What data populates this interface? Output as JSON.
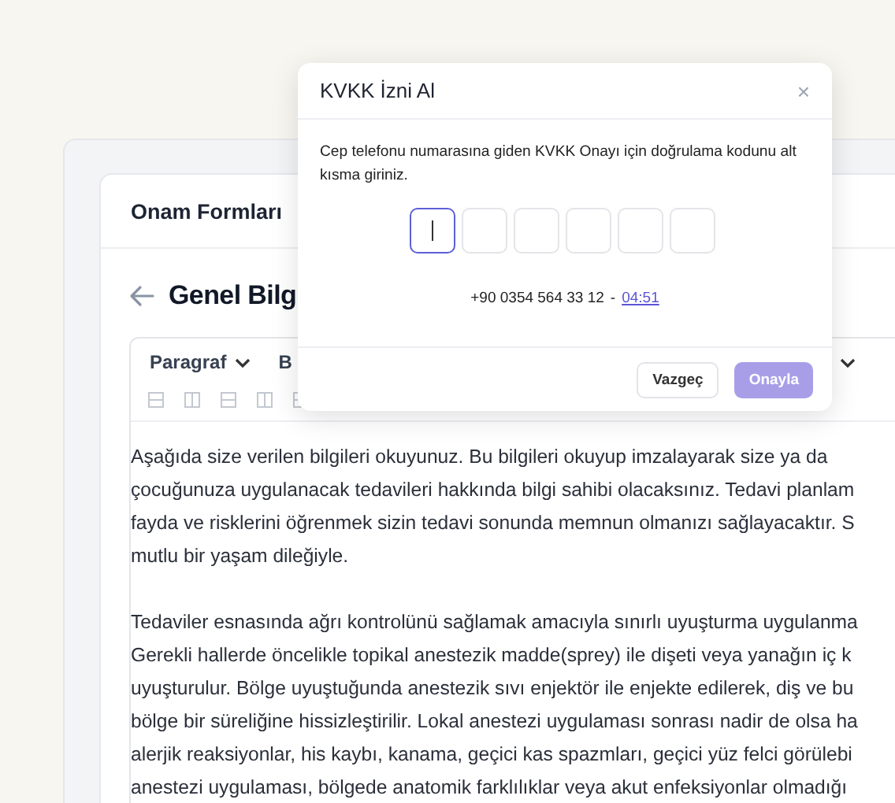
{
  "page": {
    "section_title": "Onam Formları",
    "heading": "Genel Bilg"
  },
  "editor": {
    "toolbar": {
      "block_style": "Paragraf",
      "bold_label": "B"
    },
    "paragraphs": [
      [
        "Aşağıda size verilen bilgileri okuyunuz. Bu bilgileri okuyup imzalayarak size ya da",
        "çocuğunuza uygulanacak tedavileri hakkında bilgi sahibi olacaksınız. Tedavi planlam",
        "fayda ve risklerini öğrenmek sizin tedavi sonunda memnun olmanızı sağlayacaktır. S",
        "mutlu bir yaşam dileğiyle."
      ],
      [
        "Tedaviler esnasında ağrı kontrolünü sağlamak amacıyla sınırlı uyuşturma uygulanma",
        "Gerekli hallerde öncelikle topikal anestezik madde(sprey) ile dişeti veya yanağın iç k",
        "uyuşturulur. Bölge uyuştuğunda anestezik sıvı enjektör ile enjekte edilerek, diş ve bu",
        "bölge bir süreliğine hissizleştirilir. Lokal anestezi uygulaması sonrası nadir de olsa ha",
        "alerjik reaksiyonlar, his kaybı, kanama, geçici kas spazmları, geçici yüz felci görülebi",
        "anestezi uygulaması, bölgede anatomik farklılıklar veya akut enfeksiyonlar olmadığı"
      ]
    ]
  },
  "dialog": {
    "title": "KVKK İzni Al",
    "close": "×",
    "message": "Cep telefonu numarasına giden KVKK Onayı için doğrulama kodunu alt kısma giriniz.",
    "code_boxes": [
      {
        "focused": true
      },
      {
        "focused": false
      },
      {
        "focused": false
      },
      {
        "focused": false
      },
      {
        "focused": false
      },
      {
        "focused": false
      }
    ],
    "phone": "+90 0354 564 33 12",
    "separator": "-",
    "timer": "04:51",
    "buttons": [
      {
        "label": "Vazgeç",
        "kind": "secondary",
        "disabled": false
      },
      {
        "label": "Onayla",
        "kind": "primary",
        "disabled": true
      }
    ]
  }
}
